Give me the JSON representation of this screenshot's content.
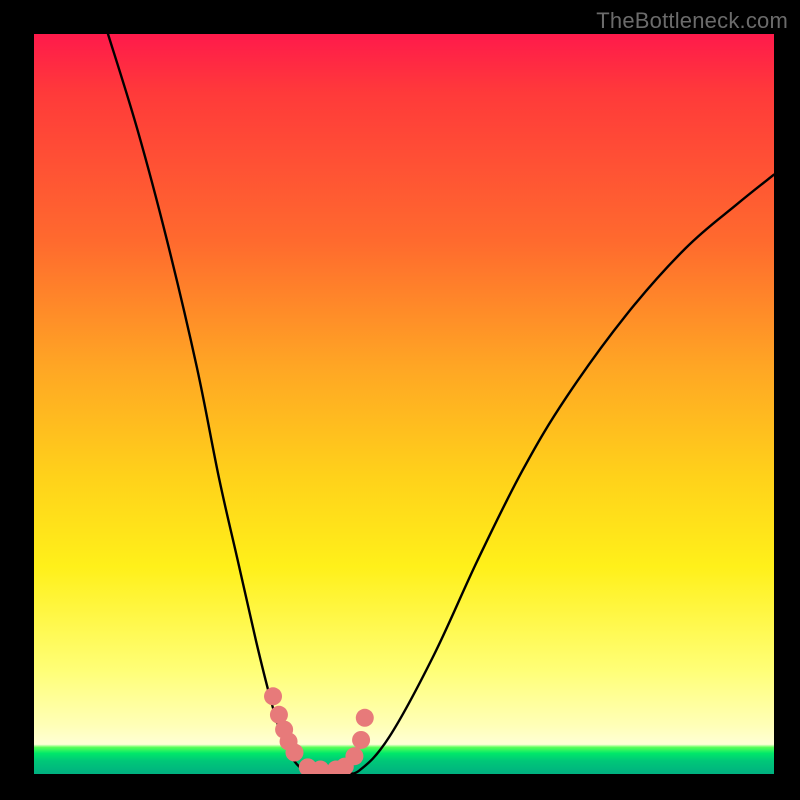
{
  "watermark": {
    "text": "TheBottleneck.com"
  },
  "colors": {
    "frame": "#000000",
    "curve": "#000000",
    "dot_fill": "#e77a7a",
    "dot_stroke": "#b94f4f"
  },
  "chart_data": {
    "type": "line",
    "title": "",
    "xlabel": "",
    "ylabel": "",
    "xlim": [
      0,
      100
    ],
    "ylim": [
      0,
      100
    ],
    "grid": false,
    "legend": false,
    "note": "Axes carry no tick labels; values below are relative percentages along each axis, estimated from the plotted geometry.",
    "series": [
      {
        "name": "left-branch",
        "x": [
          10,
          14,
          18,
          22,
          25,
          27.5,
          30,
          32,
          33.5,
          35,
          36.5
        ],
        "y": [
          100,
          87,
          72,
          55,
          40,
          29,
          18,
          10,
          5,
          2,
          0.5
        ]
      },
      {
        "name": "valley",
        "x": [
          36.5,
          38,
          40,
          42,
          44
        ],
        "y": [
          0.5,
          0.25,
          0.2,
          0.25,
          0.5
        ]
      },
      {
        "name": "right-branch",
        "x": [
          44,
          48,
          54,
          60,
          66,
          72,
          80,
          88,
          95,
          100
        ],
        "y": [
          0.5,
          5,
          16,
          29,
          41,
          51,
          62,
          71,
          77,
          81
        ]
      },
      {
        "name": "dots",
        "type": "scatter",
        "x": [
          32.3,
          33.1,
          33.8,
          34.4,
          35.2,
          37.0,
          38.7,
          40.8,
          42.0,
          43.3,
          44.2,
          44.7
        ],
        "y": [
          10.5,
          8.0,
          6.0,
          4.4,
          2.9,
          0.9,
          0.6,
          0.6,
          1.0,
          2.4,
          4.6,
          7.6
        ]
      }
    ]
  }
}
